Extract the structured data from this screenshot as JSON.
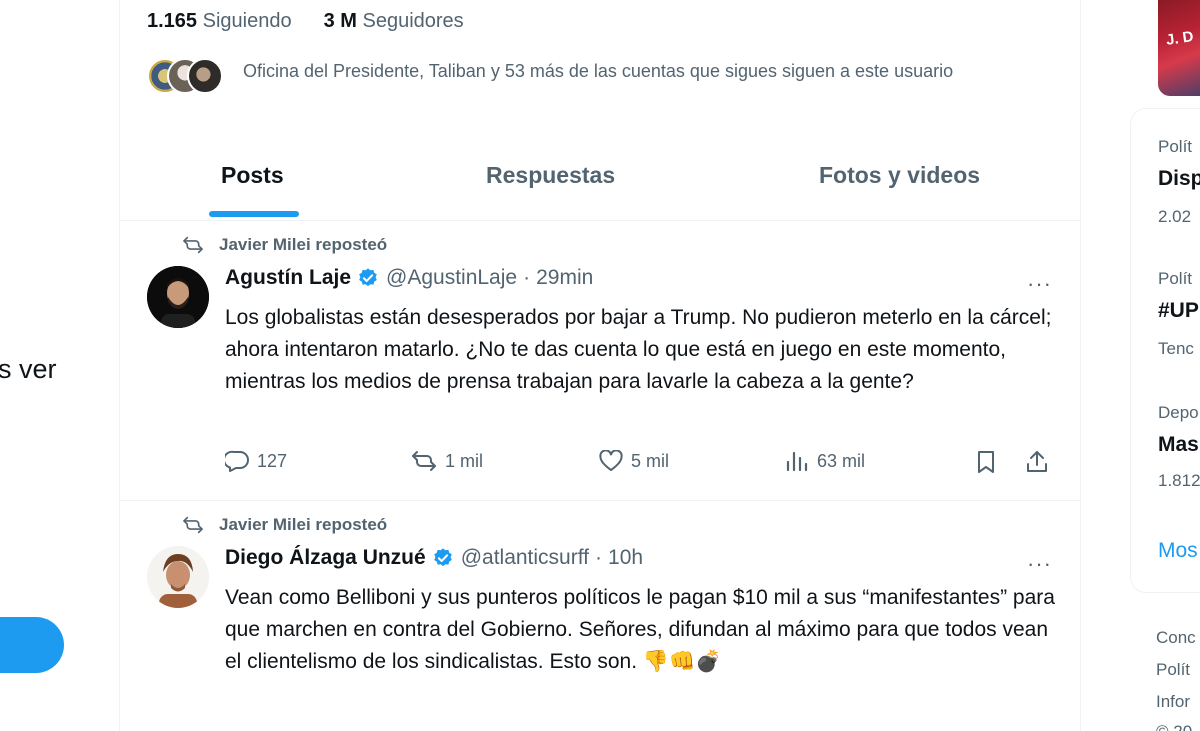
{
  "left": {
    "clipped_text": "s ver"
  },
  "profile": {
    "following_count": "1.165",
    "following_label": "Siguiendo",
    "followers_count": "3 M",
    "followers_label": "Seguidores",
    "followers_you_know": "Oficina del Presidente, Taliban y 53 más de las cuentas que sigues siguen a este usuario"
  },
  "tabs": [
    {
      "label": "Posts",
      "active": true
    },
    {
      "label": "Respuestas",
      "active": false
    },
    {
      "label": "Fotos y videos",
      "active": false
    }
  ],
  "tweets": [
    {
      "repost_label": "Javier Milei reposteó",
      "name": "Agustín Laje",
      "handle": "@AgustinLaje",
      "separator": "·",
      "time": "29min",
      "more": "···",
      "text": "Los globalistas están desesperados por bajar a Trump. No pudieron meterlo en la cárcel; ahora intentaron matarlo. ¿No te das cuenta lo que está en juego en este momento, mientras los medios de prensa trabajan para lavarle la cabeza a la gente?",
      "replies": "127",
      "reposts": "1 mil",
      "likes": "5 mil",
      "views": "63 mil"
    },
    {
      "repost_label": "Javier Milei reposteó",
      "name": "Diego Álzaga Unzué",
      "handle": "@atlanticsurff",
      "separator": "·",
      "time": "10h",
      "more": "···",
      "text": "Vean como Belliboni y sus punteros políticos le pagan $10 mil a sus “manifestantes” para que marchen en contra del Gobierno. Señores, difundan al máximo para que todos vean el clientelismo de los sindicalistas. Esto son. 👎👊💣"
    }
  ],
  "right": {
    "trends": [
      {
        "category": "Polít",
        "name": "Disp",
        "count": "2.02"
      },
      {
        "category": "Polít",
        "name": "#UP",
        "count": "Tenc"
      },
      {
        "category": "Depo",
        "name": "Mas",
        "count": "1.812"
      }
    ],
    "show_more": "Mos",
    "footer": [
      "Conc",
      "Polít",
      "Infor",
      "© 20"
    ]
  },
  "colors": {
    "accent": "#1d9bf0",
    "verified": "#1d9bf0",
    "text_primary": "#0f1419",
    "text_secondary": "#536471",
    "border": "#eff3f4"
  }
}
